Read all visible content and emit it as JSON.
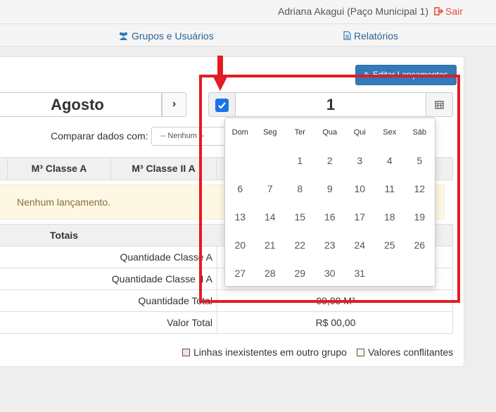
{
  "header": {
    "user": "Adriana Akagui (Paço Municipal 1)",
    "logout": "Sair"
  },
  "nav": {
    "groups": "Grupos e Usuários",
    "reports": "Relatórios"
  },
  "toolbar": {
    "edit_button": "Editar Lançamentos"
  },
  "month": {
    "value": "Agosto",
    "next": "›"
  },
  "day": {
    "checked": true,
    "value": "1"
  },
  "compare": {
    "label": "Comparar dados com:",
    "select_value": "-- Nenhum --"
  },
  "table": {
    "headers": [
      "s",
      "M³ Classe A",
      "M³ Classe II A"
    ],
    "empty": "Nenhum lançamento."
  },
  "totals": {
    "title": "Totais",
    "rows": [
      {
        "label": "Quantidade Classe A",
        "value": ""
      },
      {
        "label": "Quantidade Classe II A",
        "value": ""
      },
      {
        "label": "Quantidade Total",
        "value": "00,00 M³"
      },
      {
        "label": "Valor Total",
        "value": "R$ 00,00"
      }
    ]
  },
  "legend": {
    "missing_lines": "Linhas inexistentes em outro grupo",
    "conflicts": "Valores conflitantes"
  },
  "datepicker": {
    "weekdays": [
      "Dom",
      "Seg",
      "Ter",
      "Qua",
      "Qui",
      "Sex",
      "Sáb"
    ],
    "weeks": [
      [
        "",
        "",
        "1",
        "2",
        "3",
        "4",
        "5"
      ],
      [
        "6",
        "7",
        "8",
        "9",
        "10",
        "11",
        "12"
      ],
      [
        "13",
        "14",
        "15",
        "16",
        "17",
        "18",
        "19"
      ],
      [
        "20",
        "21",
        "22",
        "23",
        "24",
        "25",
        "26"
      ],
      [
        "27",
        "28",
        "29",
        "30",
        "31",
        "",
        ""
      ]
    ]
  },
  "colors": {
    "primary": "#337ab7",
    "logout": "#e74c3c",
    "highlight": "#e31b23",
    "alert_bg": "#fcf8e3"
  }
}
